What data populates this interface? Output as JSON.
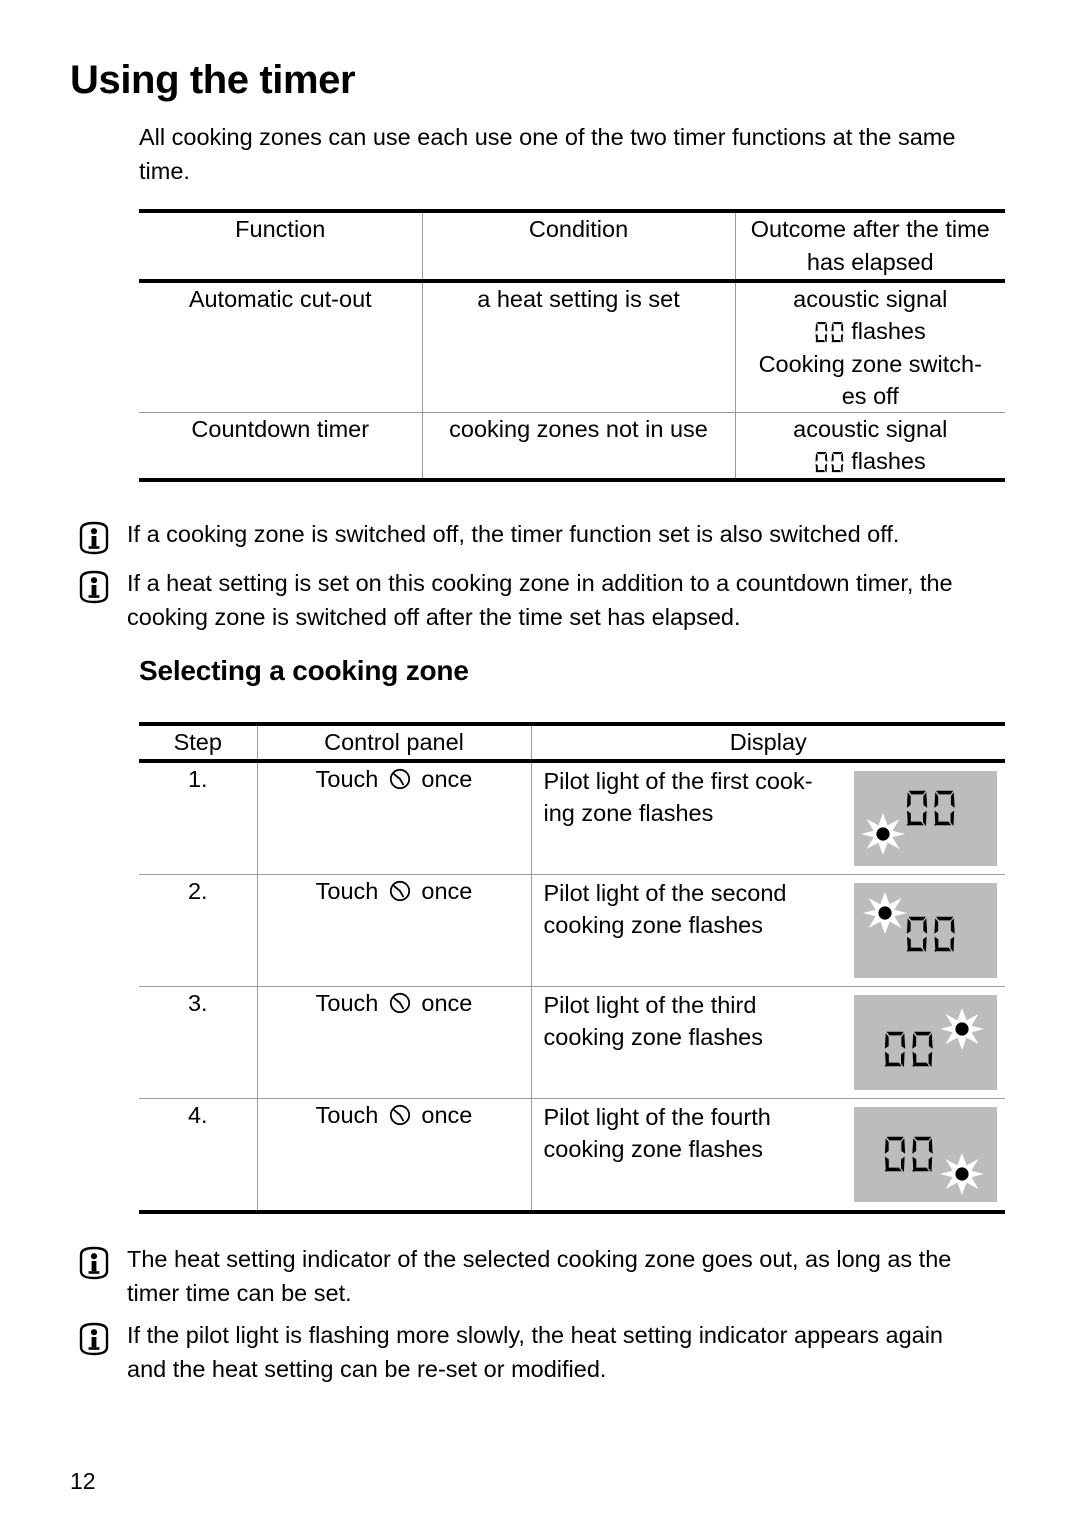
{
  "page": {
    "title": "Using the timer",
    "intro": "All cooking zones can use each use one of the two timer functions at the same time.",
    "section_title": "Selecting a cooking zone",
    "page_number": "12"
  },
  "table_functions": {
    "headers": [
      "Function",
      "Condition",
      "Outcome after the time has elapsed"
    ],
    "rows": [
      {
        "function": "Automatic cut-out",
        "condition": "a heat setting is set",
        "outcome_line1": "acoustic signal",
        "outcome_seg": "00",
        "outcome_line2": "flashes",
        "outcome_line3": "Cooking zone switch-",
        "outcome_line4": "es off"
      },
      {
        "function": "Countdown timer",
        "condition": "cooking zones not in use",
        "outcome_line1": "acoustic signal",
        "outcome_seg": "00",
        "outcome_line2": "flashes",
        "outcome_line3": "",
        "outcome_line4": ""
      }
    ]
  },
  "notes_top": [
    {
      "icon": "info-icon",
      "text": "If a cooking zone is switched off, the timer function set is also switched off."
    },
    {
      "icon": "info-icon",
      "text": "If a heat setting is set on this cooking zone in addition to a countdown timer, the cooking zone is switched off after the time set has elapsed."
    }
  ],
  "table_steps": {
    "headers": [
      "Step",
      "Control panel",
      "Display"
    ],
    "rows": [
      {
        "step": "1.",
        "control_prefix": "Touch",
        "control_icon": "timer-clock-icon",
        "control_suffix": "once",
        "description": "Pilot light of the first cook-ing zone flashes",
        "display_value": "00",
        "display_dot_position": "bottom-left"
      },
      {
        "step": "2.",
        "control_prefix": "Touch",
        "control_icon": "timer-clock-icon",
        "control_suffix": "once",
        "description": "Pilot light of the second cooking zone flashes",
        "display_value": "00",
        "display_dot_position": "top-left"
      },
      {
        "step": "3.",
        "control_prefix": "Touch",
        "control_icon": "timer-clock-icon",
        "control_suffix": "once",
        "description": "Pilot light of the third cooking zone flashes",
        "display_value": "00",
        "display_dot_position": "top-right"
      },
      {
        "step": "4.",
        "control_prefix": "Touch",
        "control_icon": "timer-clock-icon",
        "control_suffix": "once",
        "description": "Pilot light of the fourth cooking zone flashes",
        "display_value": "00",
        "display_dot_position": "bottom-right"
      }
    ]
  },
  "notes_bottom": [
    {
      "icon": "info-icon",
      "text": "The heat setting indicator of the selected cooking zone goes out, as long as the timer time can be set."
    },
    {
      "icon": "info-icon",
      "text": "If the pilot light is flashing more slowly, the heat setting indicator appears again and the heat setting can be re-set or modified."
    }
  ],
  "colors": {
    "display_background": "#bcbcbc",
    "rule_thick": "#000000",
    "rule_thin": "#9a9a9a",
    "text": "#000000"
  }
}
